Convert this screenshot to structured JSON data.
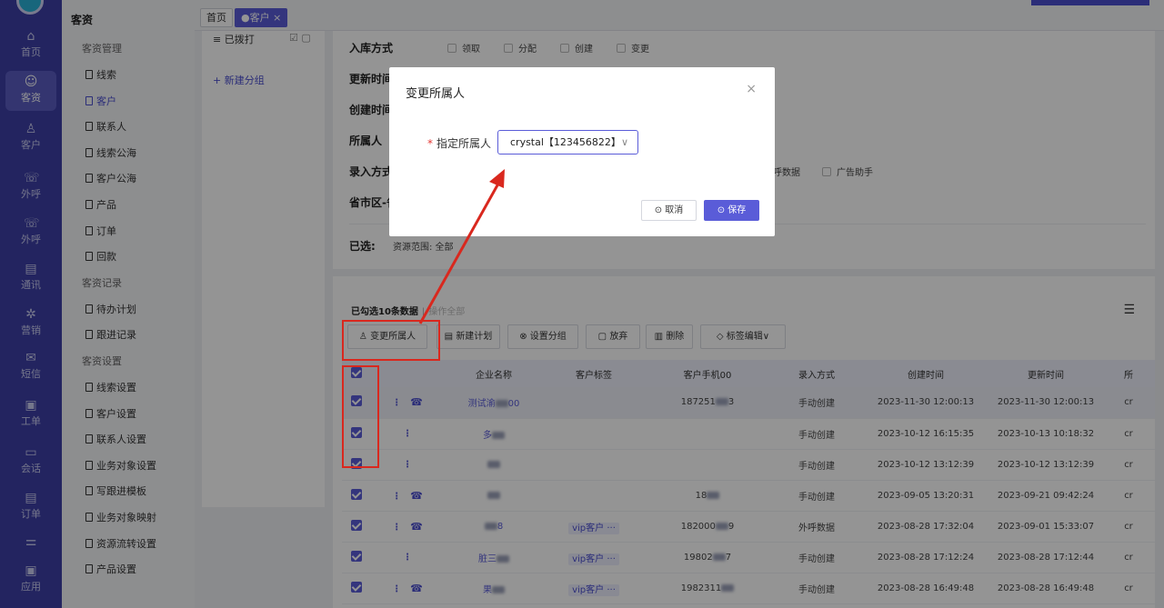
{
  "rail": {
    "items": [
      {
        "label": "首页",
        "icon": "home-icon",
        "glyph": "⌂"
      },
      {
        "label": "客资",
        "icon": "users-icon",
        "glyph": "☺"
      },
      {
        "label": "客户",
        "icon": "user-icon",
        "glyph": "♙"
      },
      {
        "label": "外呼",
        "icon": "phone-out-icon",
        "glyph": "☏"
      },
      {
        "label": "外呼",
        "icon": "phone-in-icon",
        "glyph": "☏"
      },
      {
        "label": "通讯",
        "icon": "contacts-icon",
        "glyph": "▤"
      },
      {
        "label": "营销",
        "icon": "gear-icon",
        "glyph": "✲"
      },
      {
        "label": "短信",
        "icon": "message-icon",
        "glyph": "✉"
      },
      {
        "label": "工单",
        "icon": "clipboard-icon",
        "glyph": "▣"
      },
      {
        "label": "会话",
        "icon": "chat-icon",
        "glyph": "▭"
      },
      {
        "label": "订单",
        "icon": "order-icon",
        "glyph": "▤"
      },
      {
        "label": "",
        "icon": "divider-icon",
        "glyph": "⚌"
      },
      {
        "label": "应用",
        "icon": "app-icon",
        "glyph": "▣"
      }
    ]
  },
  "sidebar": {
    "title": "客资",
    "groups": [
      {
        "label": "客资管理",
        "items": [
          "线索",
          "客户",
          "联系人",
          "线索公海",
          "客户公海",
          "产品",
          "订单",
          "回款"
        ]
      },
      {
        "label": "客资记录",
        "items": [
          "待办计划",
          "跟进记录"
        ]
      },
      {
        "label": "客资设置",
        "items": [
          "线索设置",
          "客户设置",
          "联系人设置",
          "业务对象设置",
          "写跟进模板",
          "业务对象映射",
          "资源流转设置",
          "产品设置"
        ]
      }
    ],
    "active_item": "客户"
  },
  "tabs": {
    "home": "首页",
    "customer": "●客户 ×"
  },
  "groups_panel": {
    "dialed": "≡ 已拨打",
    "new_group": "+ 新建分组",
    "edit_icons": "☑ ▢"
  },
  "filters": {
    "inbound_label": "入库方式",
    "inbound_options": [
      "领取",
      "分配",
      "创建",
      "变更"
    ],
    "update_time_label": "更新时间",
    "create_time_label": "创建时间",
    "owner_label": "所属人",
    "entry_label": "录入方式",
    "entry_options": [
      "呼数据",
      "广告助手"
    ],
    "region_label": "省市区-省",
    "selected_label": "已选:",
    "selected_value": "资源范围: 全部"
  },
  "data_panel": {
    "selected_count": "已勾选10条数据",
    "operate_all": "操作全部",
    "toolbar": [
      "变更所属人",
      "新建计划",
      "设置分组",
      "放弃",
      "删除",
      "标签编辑"
    ],
    "columns": [
      "企业名称",
      "客户标签",
      "客户手机00",
      "录入方式",
      "创建时间",
      "更新时间",
      "所"
    ],
    "rows": [
      {
        "name": "测试渝",
        "name_suffix": "00",
        "tag": "",
        "phone": "187251",
        "phone_suffix": "3",
        "entry": "手动创建",
        "created": "2023-11-30 12:00:13",
        "updated": "2023-11-30 12:00:13",
        "owner": "cr",
        "has_phone": true
      },
      {
        "name": "多",
        "name_suffix": "",
        "tag": "",
        "phone": "",
        "phone_suffix": "",
        "entry": "手动创建",
        "created": "2023-10-12 16:15:35",
        "updated": "2023-10-13 10:18:32",
        "owner": "cr",
        "has_phone": false
      },
      {
        "name": "",
        "name_suffix": "",
        "tag": "",
        "phone": "",
        "phone_suffix": "",
        "entry": "手动创建",
        "created": "2023-10-12 13:12:39",
        "updated": "2023-10-12 13:12:39",
        "owner": "cr",
        "has_phone": false
      },
      {
        "name": "",
        "name_suffix": "",
        "tag": "",
        "phone": "18",
        "phone_suffix": "",
        "entry": "手动创建",
        "created": "2023-09-05 13:20:31",
        "updated": "2023-09-21 09:42:24",
        "owner": "cr",
        "has_phone": true
      },
      {
        "name": "",
        "name_suffix": "8",
        "tag": "vip客户 ···",
        "phone": "182000",
        "phone_suffix": "9",
        "entry": "外呼数据",
        "created": "2023-08-28 17:32:04",
        "updated": "2023-09-01 15:33:07",
        "owner": "cr",
        "has_phone": true
      },
      {
        "name": "脏三",
        "name_suffix": "",
        "tag": "vip客户 ···",
        "phone": "19802",
        "phone_suffix": "7",
        "entry": "手动创建",
        "created": "2023-08-28 17:12:24",
        "updated": "2023-08-28 17:12:44",
        "owner": "cr",
        "has_phone": false
      },
      {
        "name": "果",
        "name_suffix": "",
        "tag": "vip客户 ···",
        "phone": "1982311",
        "phone_suffix": "",
        "entry": "手动创建",
        "created": "2023-08-28 16:49:48",
        "updated": "2023-08-28 16:49:48",
        "owner": "cr",
        "has_phone": true
      }
    ]
  },
  "modal": {
    "title": "变更所属人",
    "close": "×",
    "field_label": "指定所属人",
    "required_mark": "*",
    "selected_value": "crystal【123456822】",
    "cancel": "⊙ 取消",
    "save": "⊙ 保存"
  },
  "colors": {
    "accent": "#5a5cd8",
    "rail": "#3d3fa6",
    "annotation": "#d9281e"
  }
}
